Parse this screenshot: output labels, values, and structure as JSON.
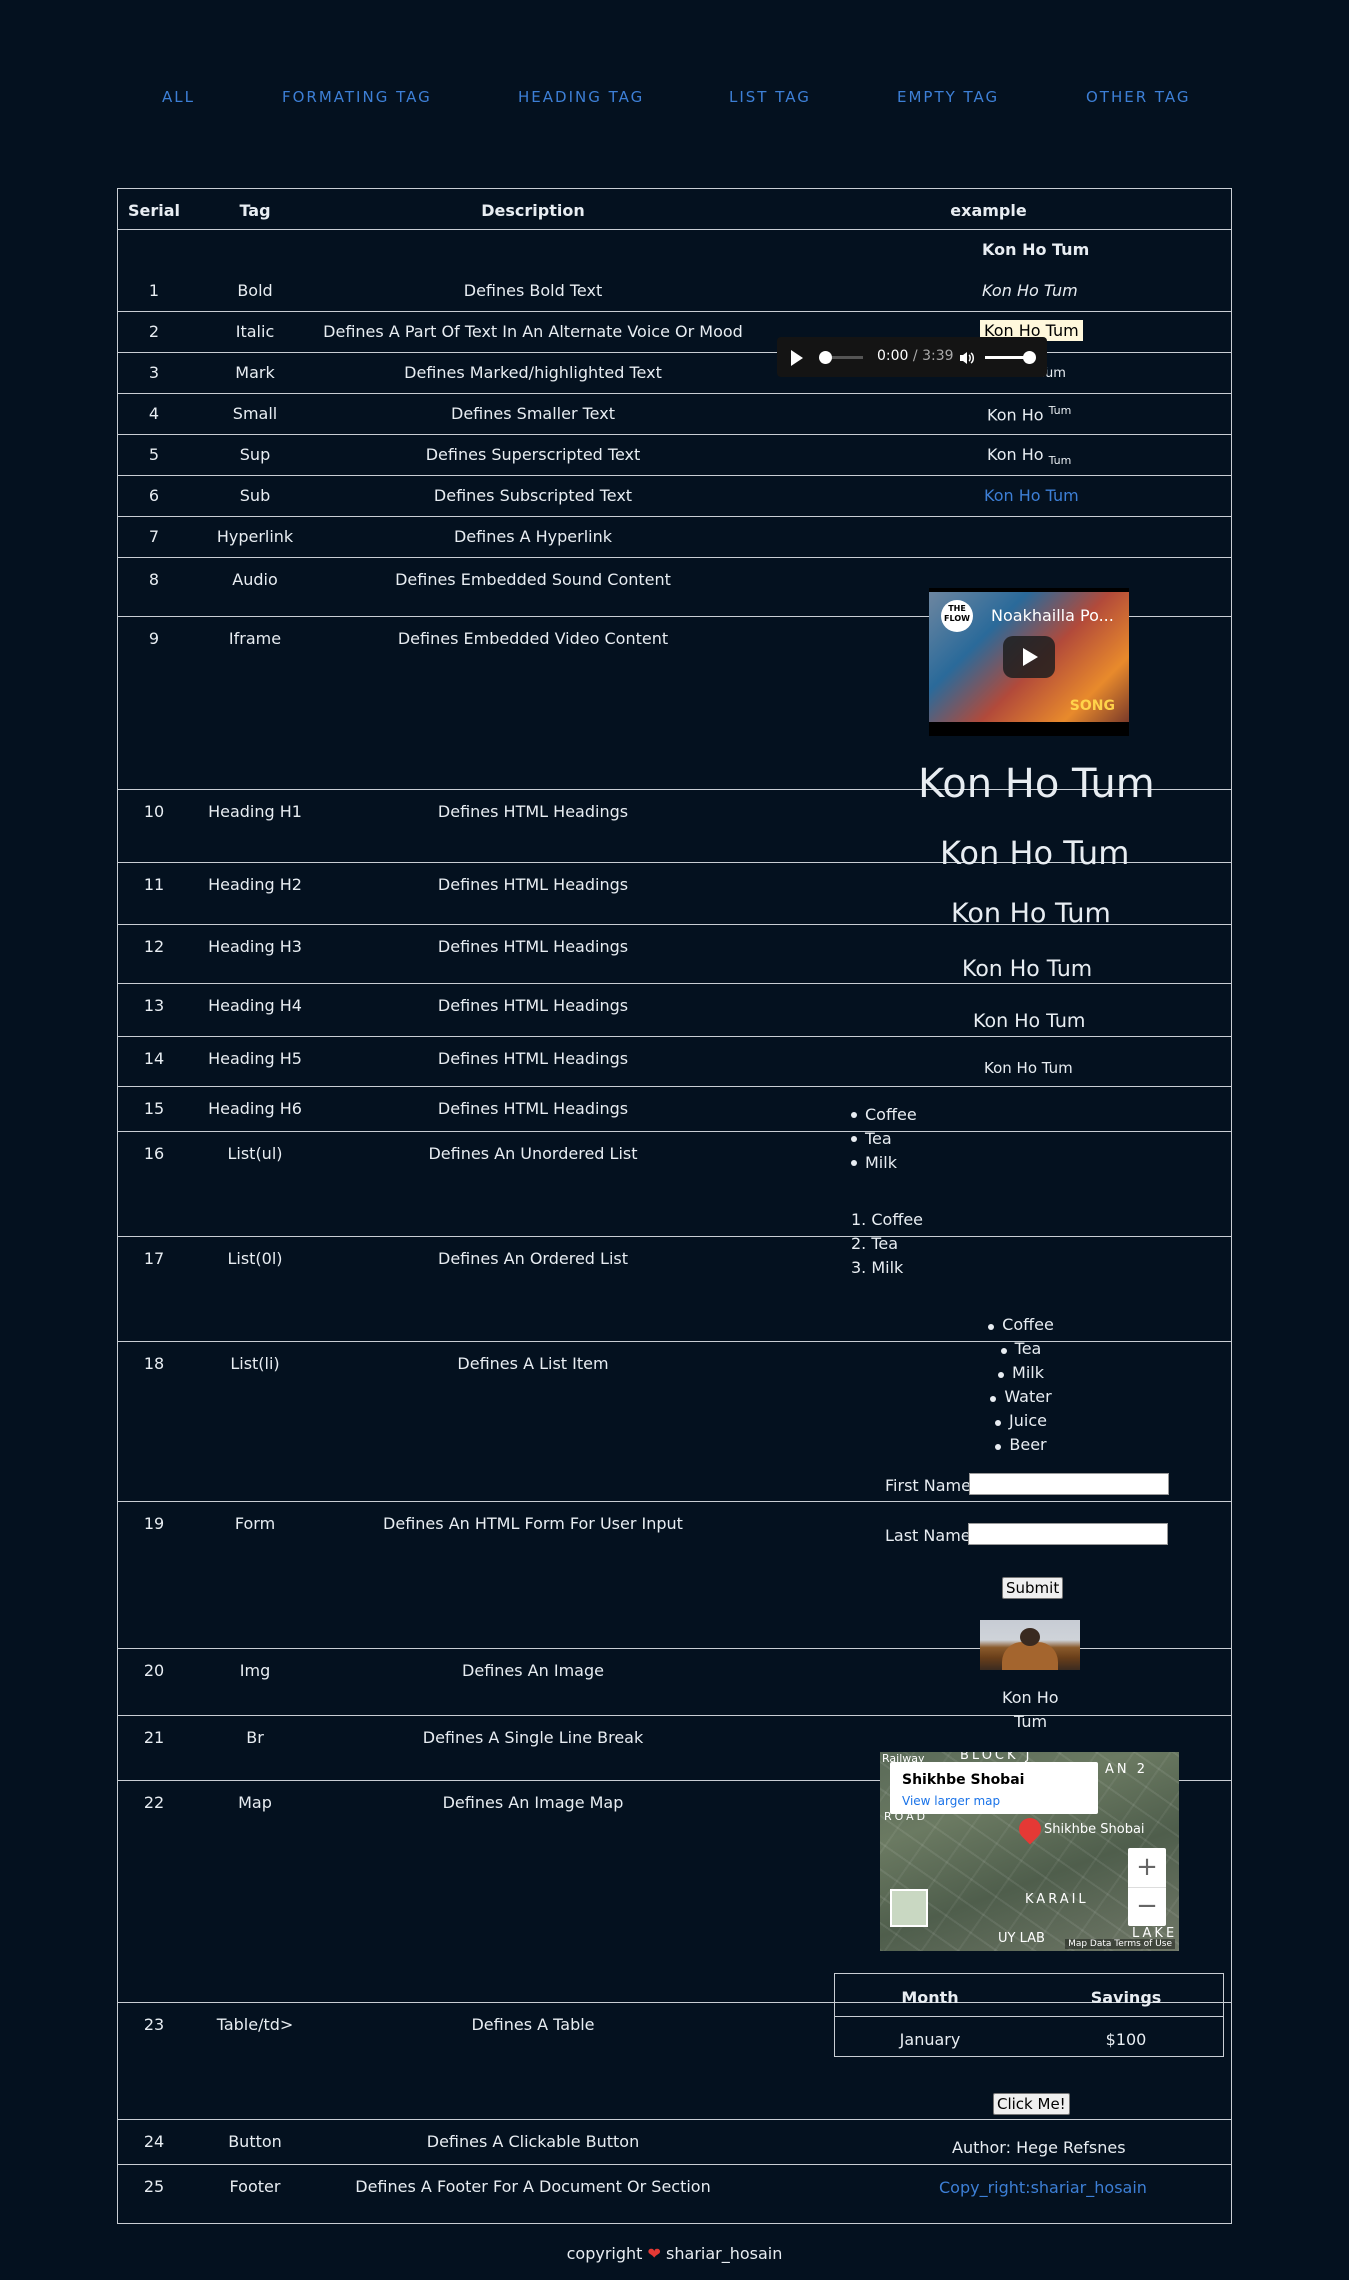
{
  "nav": [
    "ALL",
    "FORMATING TAG",
    "HEADING TAG",
    "LIST TAG",
    "EMPTY TAG",
    "OTHER TAG"
  ],
  "table": {
    "headers": {
      "serial": "Serial",
      "tag": "Tag",
      "description": "Description",
      "example": "example"
    },
    "rows": [
      {
        "serial": "1",
        "tag": "Bold",
        "description": "Defines Bold Text"
      },
      {
        "serial": "2",
        "tag": "Italic",
        "description": "Defines A Part Of Text In An Alternate Voice Or Mood"
      },
      {
        "serial": "3",
        "tag": "Mark",
        "description": "Defines Marked/highlighted Text"
      },
      {
        "serial": "4",
        "tag": "Small",
        "description": "Defines Smaller Text"
      },
      {
        "serial": "5",
        "tag": "Sup",
        "description": "Defines Superscripted Text"
      },
      {
        "serial": "6",
        "tag": "Sub",
        "description": "Defines Subscripted Text"
      },
      {
        "serial": "7",
        "tag": "Hyperlink",
        "description": "Defines A Hyperlink"
      },
      {
        "serial": "8",
        "tag": "Audio",
        "description": "Defines Embedded Sound Content"
      },
      {
        "serial": "9",
        "tag": "Iframe",
        "description": "Defines Embedded Video Content"
      },
      {
        "serial": "10",
        "tag": "Heading H1",
        "description": "Defines HTML Headings"
      },
      {
        "serial": "11",
        "tag": "Heading H2",
        "description": "Defines HTML Headings"
      },
      {
        "serial": "12",
        "tag": "Heading H3",
        "description": "Defines HTML Headings"
      },
      {
        "serial": "13",
        "tag": "Heading H4",
        "description": "Defines HTML Headings"
      },
      {
        "serial": "14",
        "tag": "Heading H5",
        "description": "Defines HTML Headings"
      },
      {
        "serial": "15",
        "tag": "Heading H6",
        "description": "Defines HTML Headings"
      },
      {
        "serial": "16",
        "tag": "List(ul)",
        "description": "Defines An Unordered List"
      },
      {
        "serial": "17",
        "tag": "List(0l)",
        "description": "Defines An Ordered List"
      },
      {
        "serial": "18",
        "tag": "List(li)",
        "description": "Defines A List Item"
      },
      {
        "serial": "19",
        "tag": "Form",
        "description": "Defines An HTML Form For User Input"
      },
      {
        "serial": "20",
        "tag": "Img",
        "description": "Defines An Image"
      },
      {
        "serial": "21",
        "tag": "Br",
        "description": "Defines A Single Line Break"
      },
      {
        "serial": "22",
        "tag": "Map",
        "description": "Defines An Image Map"
      },
      {
        "serial": "23",
        "tag": "Table/td>",
        "description": "Defines A Table"
      },
      {
        "serial": "24",
        "tag": "Button",
        "description": "Defines A Clickable Button"
      },
      {
        "serial": "25",
        "tag": "Footer",
        "description": "Defines A Footer For A Document Or Section"
      }
    ]
  },
  "examples": {
    "text": "Kon Ho Tum",
    "sup_base": "Kon Ho",
    "sup_text": "Tum",
    "sub_base": "Kon Ho",
    "sub_text": "Tum",
    "audio": {
      "current": "0:00",
      "duration": "/ 3:39",
      "progress": 0.0
    },
    "video": {
      "title": "Noakhailla Po...",
      "logo": "THE FLOW",
      "song_label": "SONG"
    },
    "ul_items": [
      "Coffee",
      "Tea",
      "Milk"
    ],
    "ol_items": [
      "1. Coffee",
      "2. Tea",
      "3. Milk"
    ],
    "li_items": [
      "Coffee",
      "Tea",
      "Milk",
      "Water",
      "Juice",
      "Beer"
    ],
    "form": {
      "first_label": "First Name:",
      "last_label": "Last Name:",
      "first_value": "",
      "last_value": "",
      "submit": "Submit"
    },
    "br_line1": "Kon Ho",
    "br_line2": "Tum",
    "map": {
      "place": "Shikhbe Shobai",
      "link": "View larger map",
      "pin_label": "Shikhbe Shobai",
      "labels": [
        "BLOCK J",
        "AN 2",
        "KARAIL",
        "LAKE",
        "UY LAB",
        "Railway",
        "ROAD"
      ],
      "zoom_in": "+",
      "zoom_out": "−",
      "footer": "Map Data   Terms of Use"
    },
    "inner_table": {
      "headers": [
        "Month",
        "Savings"
      ],
      "rows": [
        [
          "January",
          "$100"
        ]
      ]
    },
    "button": "Click Me!",
    "footer_author": "Author: Hege Refsnes",
    "footer_link": "Copy_right:shariar_hosain"
  },
  "copyright": {
    "prefix": "copyright",
    "name": "shariar_hosain"
  },
  "colors": {
    "background": "#04111f",
    "link": "#3d7fd6",
    "border": "#c9ced4",
    "heart": "#e53935"
  }
}
